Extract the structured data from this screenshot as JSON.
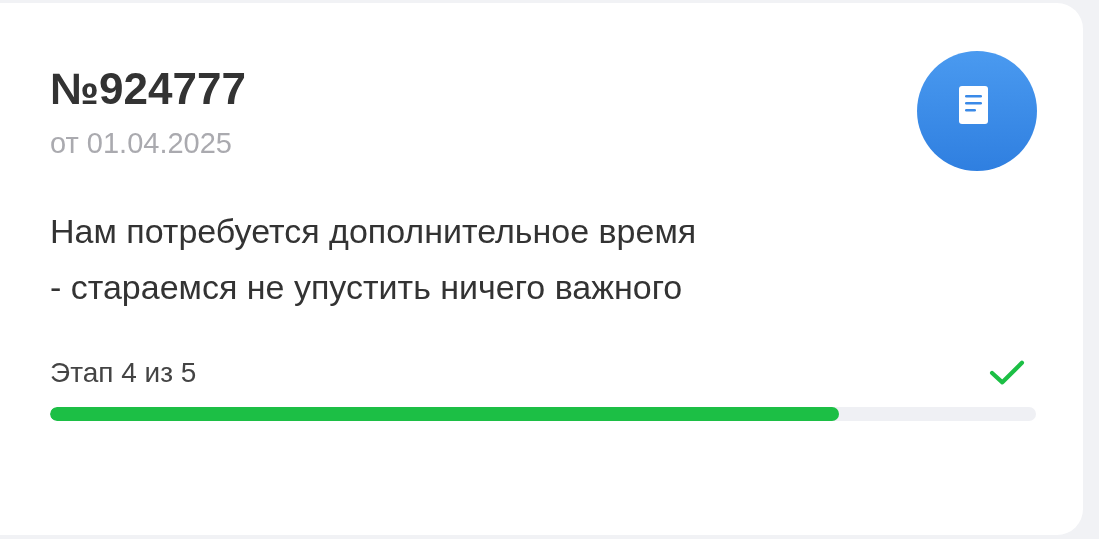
{
  "order": {
    "number": "№924777",
    "date": "от 01.04.2025"
  },
  "message": [
    "Нам потребуется дополнительное время",
    "- стараемся не упустить ничего важного"
  ],
  "progress": {
    "label": "Этап 4 из 5",
    "checked": true,
    "level": 0.8
  }
}
